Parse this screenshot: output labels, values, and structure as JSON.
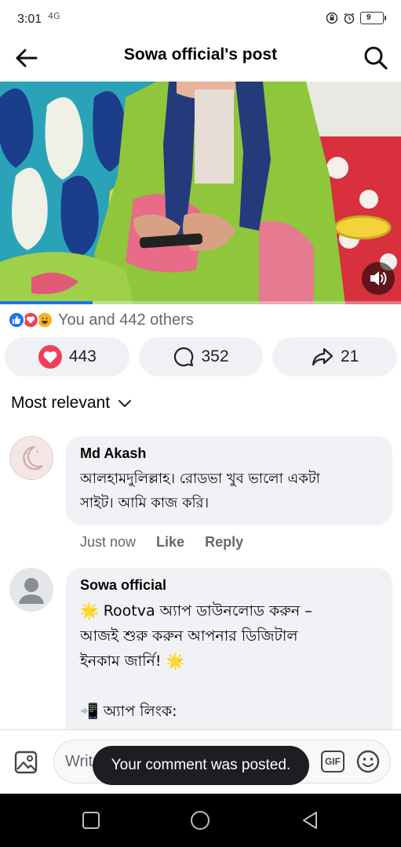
{
  "status_bar": {
    "time": "3:01",
    "signal": "4G",
    "battery": "9"
  },
  "header": {
    "title": "Sowa official's post"
  },
  "video": {
    "progress_fraction": 0.23
  },
  "reactions": {
    "summary": "You and 442 others"
  },
  "actions": {
    "like_count": "443",
    "comment_count": "352",
    "share_count": "21"
  },
  "sort": {
    "label": "Most relevant"
  },
  "comments": [
    {
      "author": "Md Akash",
      "text": "আলহামদুলিল্লাহ। রোডভা খুব ভালো একটা\nসাইট। আমি কাজ করি।",
      "time": "Just now",
      "like": "Like",
      "reply": "Reply"
    },
    {
      "author": "Sowa official",
      "text": "🌟 Rootva অ্যাপ ডাউনলোড করুন –\nআজই শুরু করুন আপনার ডিজিটাল\nইনকাম জার্নি! 🌟\n\n📲 অ্যাপ লিংক:"
    }
  ],
  "composer": {
    "placeholder": "Write",
    "gif": "GIF"
  },
  "toast": {
    "message": "Your comment was posted."
  },
  "colors": {
    "accent": "#1877f2",
    "love": "#f33e58",
    "pill_bg": "#eff1f4",
    "bubble_bg": "#f0f2f5"
  }
}
